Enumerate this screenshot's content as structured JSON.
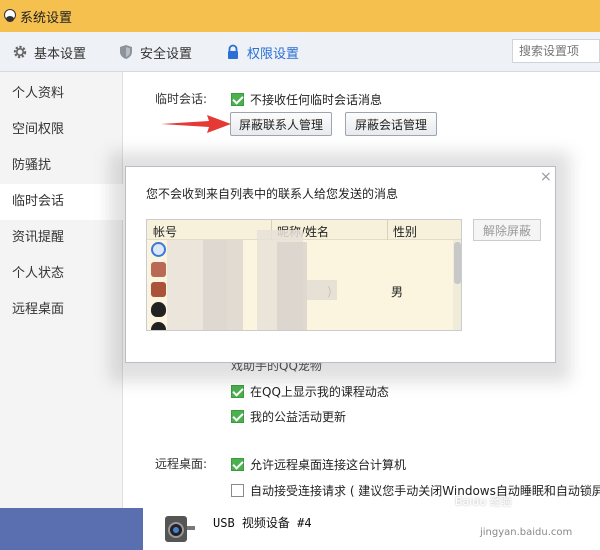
{
  "window": {
    "title": "系统设置"
  },
  "nav": {
    "tabs": [
      {
        "label": "基本设置",
        "icon": "gear-icon"
      },
      {
        "label": "安全设置",
        "icon": "shield-icon"
      },
      {
        "label": "权限设置",
        "icon": "lock-icon",
        "active": true
      }
    ],
    "search_placeholder": "搜索设置项"
  },
  "sidebar": {
    "items": [
      {
        "label": "个人资料"
      },
      {
        "label": "空间权限"
      },
      {
        "label": "防骚扰"
      },
      {
        "label": "临时会话",
        "active": true
      },
      {
        "label": "资讯提醒"
      },
      {
        "label": "个人状态"
      },
      {
        "label": "远程桌面"
      }
    ]
  },
  "main": {
    "temp_session": {
      "label": "临时会话:",
      "reject_checkbox": {
        "label": "不接收任何临时会话消息",
        "checked": true
      },
      "block_contacts_button": "屏蔽联系人管理",
      "block_sessions_button": "屏蔽会话管理"
    },
    "partial_row_text": "戏助手的QQ宠物",
    "course_checkbox": {
      "label": "在QQ上显示我的课程动态",
      "checked": true
    },
    "charity_checkbox": {
      "label": "我的公益活动更新",
      "checked": true
    },
    "remote_desktop": {
      "label": "远程桌面:",
      "allow_checkbox": {
        "label": "允许远程桌面连接这台计算机",
        "checked": true
      },
      "auto_accept_checkbox": {
        "label": "自动接受连接请求 ( 建议您手动关闭Windows自动睡眠和自动锁屏功",
        "checked": false
      }
    }
  },
  "dialog": {
    "message": "您不会收到来自列表中的联系人给您发送的消息",
    "columns": [
      "帐号",
      "昵称/姓名",
      "性别"
    ],
    "rows": [
      {
        "account": "",
        "nickname": "",
        "gender": ""
      },
      {
        "account": "",
        "nickname": "",
        "gender": ""
      },
      {
        "account": "",
        "nickname": "）",
        "gender": "男"
      },
      {
        "account": "",
        "nickname": "",
        "gender": ""
      },
      {
        "account": "",
        "nickname": "",
        "gender": ""
      }
    ],
    "unblock_button": "解除屏蔽",
    "close_glyph": "×"
  },
  "background_window": {
    "device_label": "USB 视频设备 #4"
  },
  "watermark": {
    "main": "Baidu 经验",
    "url": "jingyan.baidu.com"
  },
  "colors": {
    "title_bar": "#f5c04d",
    "active_tab": "#2a6fd6",
    "checkbox_checked": "#4caf50",
    "arrow": "#e53935"
  }
}
